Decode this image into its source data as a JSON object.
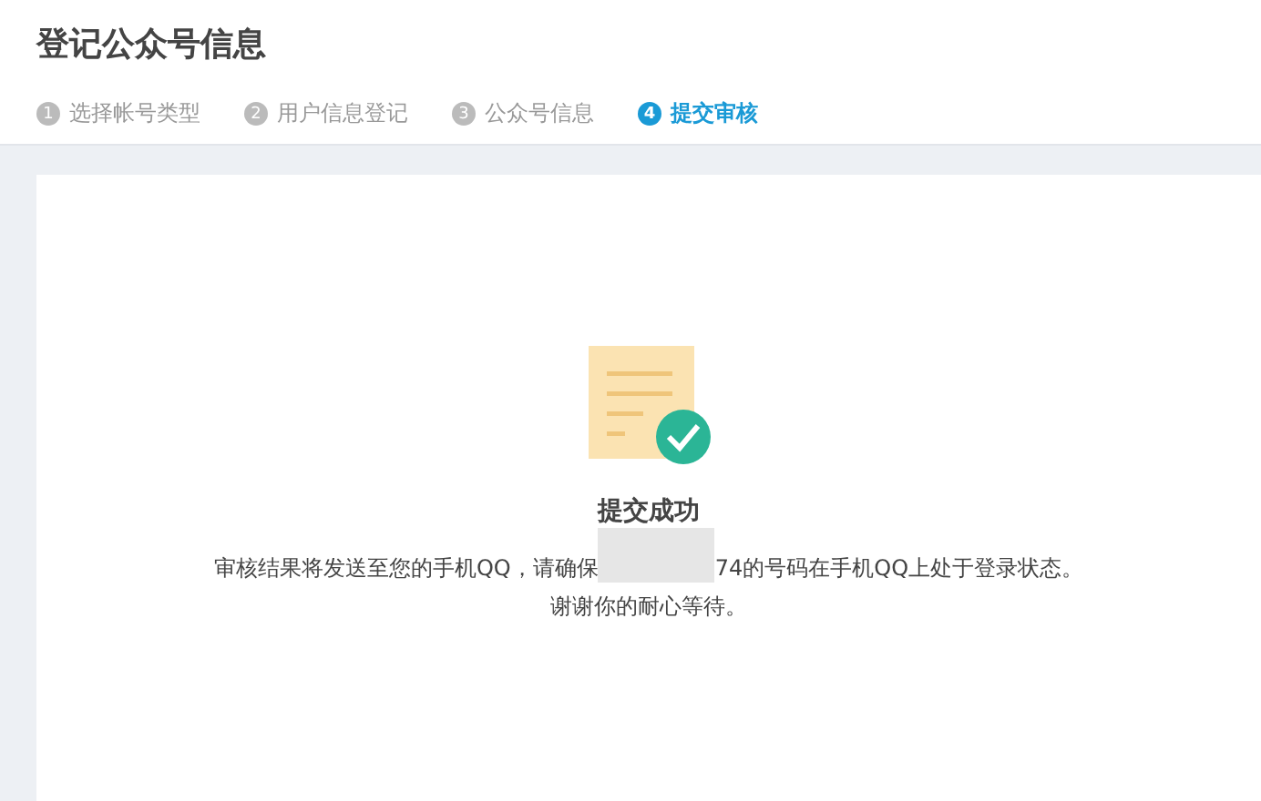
{
  "page_title": "登记公众号信息",
  "steps": [
    {
      "number": "1",
      "label": "选择帐号类型",
      "selected": false
    },
    {
      "number": "2",
      "label": "用户信息登记",
      "selected": false
    },
    {
      "number": "3",
      "label": "公众号信息",
      "selected": false
    },
    {
      "number": "4",
      "label": "提交审核",
      "selected": true
    }
  ],
  "result": {
    "title": "提交成功",
    "message_before": "审核结果将发送至您的手机QQ，请确保",
    "message_after": "74的号码在手机QQ上处于登录状态。",
    "message_line2": "谢谢你的耐心等待。"
  }
}
